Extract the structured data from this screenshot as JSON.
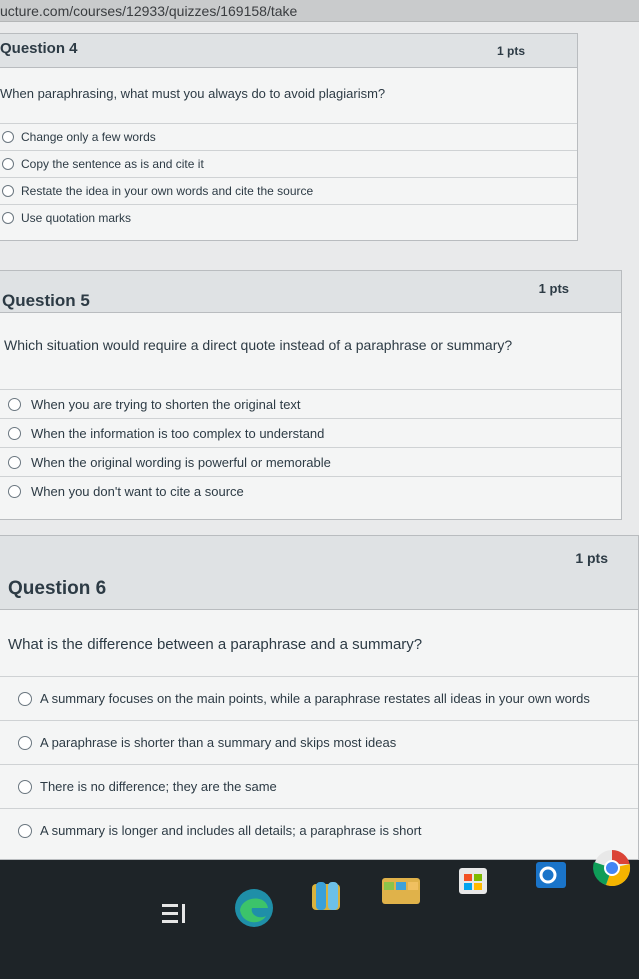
{
  "url": "ucture.com/courses/12933/quizzes/169158/take",
  "questions": [
    {
      "title": "Question 4",
      "points": "1 pts",
      "text": "When paraphrasing, what must you always do to avoid plagiarism?",
      "answers": [
        "Change only a few words",
        "Copy the sentence as is and cite it",
        "Restate the idea in your own words and cite the source",
        "Use quotation marks"
      ]
    },
    {
      "title": "Question 5",
      "points": "1 pts",
      "text": "Which situation would require a direct quote instead of a paraphrase or summary?",
      "answers": [
        "When you are trying to shorten the original text",
        "When the information is too complex to understand",
        "When the original wording is powerful or memorable",
        "When you don't want to cite a source"
      ]
    },
    {
      "title": "Question 6",
      "points": "1 pts",
      "text": "What is the difference between a paraphrase and a summary?",
      "answers": [
        "A summary focuses on the main points, while a paraphrase restates all ideas in your own words",
        "A paraphrase is shorter than a summary and skips most ideas",
        "There is no difference; they are the same",
        "A summary is longer and includes all details; a paraphrase is short"
      ]
    }
  ],
  "taskbar": {
    "icons": [
      "task-view-icon",
      "edge-icon",
      "file-explorer-icon",
      "store-icon",
      "outlook-icon",
      "chrome-icon"
    ]
  }
}
